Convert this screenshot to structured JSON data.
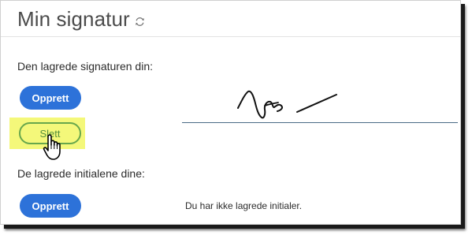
{
  "page": {
    "title": "Min signatur",
    "refresh_icon": "refresh-icon"
  },
  "signature_section": {
    "label": "Den lagrede signaturen din:",
    "create_button": "Opprett",
    "delete_button": "Slett"
  },
  "initials_section": {
    "label": "De lagrede initialene dine:",
    "create_button": "Opprett",
    "empty_message": "Du har ikke lagrede initialer."
  },
  "colors": {
    "primary_button": "#2d72d9",
    "highlight": "#f4f87a",
    "delete_button_border": "#67a74c"
  }
}
